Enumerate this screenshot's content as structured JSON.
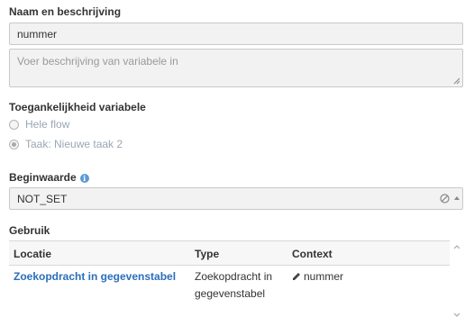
{
  "name_section": {
    "label": "Naam en beschrijving",
    "name_value": "nummer",
    "description_placeholder": "Voer beschrijving van variabele in"
  },
  "access_section": {
    "label": "Toegankelijkheid variabele",
    "options": [
      {
        "label": "Hele flow",
        "checked": false
      },
      {
        "label": "Taak: Nieuwe taak 2",
        "checked": true
      }
    ]
  },
  "initial_section": {
    "label": "Beginwaarde",
    "value": "NOT_SET"
  },
  "usage_section": {
    "label": "Gebruik",
    "columns": [
      "Locatie",
      "Type",
      "Context"
    ],
    "rows": [
      {
        "location": "Zoekopdracht in gegevenstabel",
        "type_line1": "Zoekopdracht in",
        "type_line2": "gegevenstabel",
        "context": "nummer"
      }
    ]
  },
  "colors": {
    "link": "#2a6ebb",
    "info": "#5b9bd5",
    "disabled_text": "#9aa7b4",
    "field_bg": "#f2f2f2"
  },
  "icons": [
    "info-icon",
    "clear-icon",
    "caret-down-icon",
    "pencil-icon",
    "scroll-up-icon",
    "scroll-down-icon",
    "resize-grip-icon"
  ]
}
